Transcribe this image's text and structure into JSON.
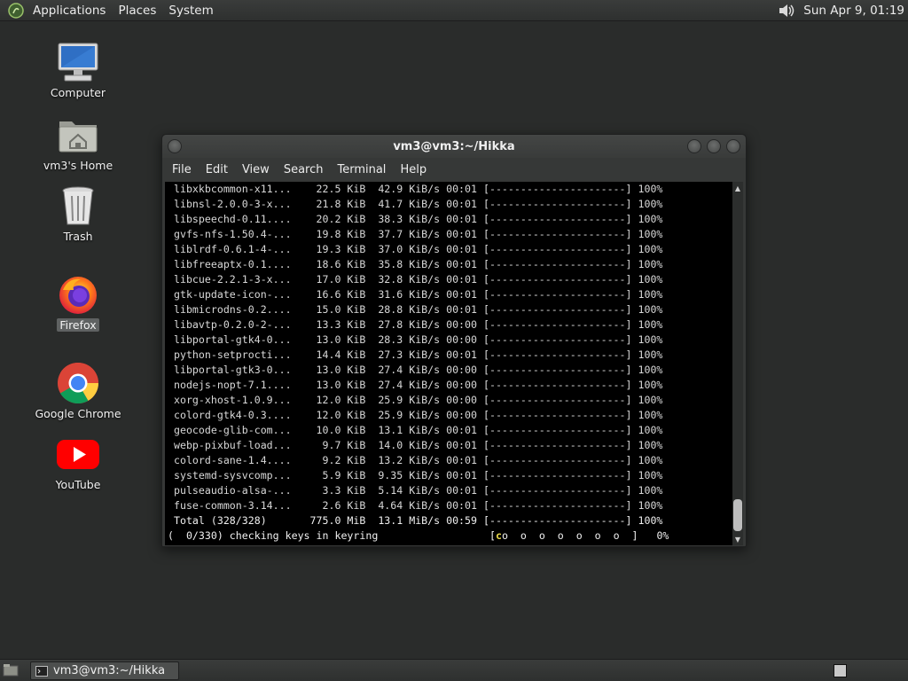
{
  "top_panel": {
    "menus": [
      "Applications",
      "Places",
      "System"
    ],
    "clock": "Sun Apr  9, 01:19"
  },
  "desktop_icons": [
    {
      "label": "Computer",
      "icon": "computer-icon"
    },
    {
      "label": "vm3's Home",
      "icon": "home-folder-icon"
    },
    {
      "label": "Trash",
      "icon": "trash-icon"
    },
    {
      "label": "Firefox",
      "icon": "firefox-icon"
    },
    {
      "label": "Google Chrome",
      "icon": "chrome-icon"
    },
    {
      "label": "YouTube",
      "icon": "youtube-icon"
    }
  ],
  "terminal": {
    "title": "vm3@vm3:~/Hikka",
    "menu": [
      "File",
      "Edit",
      "View",
      "Search",
      "Terminal",
      "Help"
    ],
    "lines": [
      " libxkbcommon-x11...    22.5 KiB  42.9 KiB/s 00:01 [----------------------] 100%",
      " libnsl-2.0.0-3-x...    21.8 KiB  41.7 KiB/s 00:01 [----------------------] 100%",
      " libspeechd-0.11....    20.2 KiB  38.3 KiB/s 00:01 [----------------------] 100%",
      " gvfs-nfs-1.50.4-...    19.8 KiB  37.7 KiB/s 00:01 [----------------------] 100%",
      " liblrdf-0.6.1-4-...    19.3 KiB  37.0 KiB/s 00:01 [----------------------] 100%",
      " libfreeaptx-0.1....    18.6 KiB  35.8 KiB/s 00:01 [----------------------] 100%",
      " libcue-2.2.1-3-x...    17.0 KiB  32.8 KiB/s 00:01 [----------------------] 100%",
      " gtk-update-icon-...    16.6 KiB  31.6 KiB/s 00:01 [----------------------] 100%",
      " libmicrodns-0.2....    15.0 KiB  28.8 KiB/s 00:01 [----------------------] 100%",
      " libavtp-0.2.0-2-...    13.3 KiB  27.8 KiB/s 00:00 [----------------------] 100%",
      " libportal-gtk4-0...    13.0 KiB  28.3 KiB/s 00:00 [----------------------] 100%",
      " python-setprocti...    14.4 KiB  27.3 KiB/s 00:01 [----------------------] 100%",
      " libportal-gtk3-0...    13.0 KiB  27.4 KiB/s 00:00 [----------------------] 100%",
      " nodejs-nopt-7.1....    13.0 KiB  27.4 KiB/s 00:00 [----------------------] 100%",
      " xorg-xhost-1.0.9...    12.0 KiB  25.9 KiB/s 00:00 [----------------------] 100%",
      " colord-gtk4-0.3....    12.0 KiB  25.9 KiB/s 00:00 [----------------------] 100%",
      " geocode-glib-com...    10.0 KiB  13.1 KiB/s 00:01 [----------------------] 100%",
      " webp-pixbuf-load...     9.7 KiB  14.0 KiB/s 00:01 [----------------------] 100%",
      " colord-sane-1.4....     9.2 KiB  13.2 KiB/s 00:01 [----------------------] 100%",
      " systemd-sysvcomp...     5.9 KiB  9.35 KiB/s 00:01 [----------------------] 100%",
      " pulseaudio-alsa-...     3.3 KiB  5.14 KiB/s 00:01 [----------------------] 100%",
      " fuse-common-3.14...     2.6 KiB  4.64 KiB/s 00:01 [----------------------] 100%",
      " Total (328/328)       775.0 MiB  13.1 MiB/s 00:59 [----------------------] 100%"
    ],
    "status_line": {
      "prefix": "(  0/330) checking keys in keyring                  [",
      "pac": "c",
      "dots": "o  o  o  o  o  o  o  ]   0%"
    }
  },
  "taskbar": {
    "task_label": "vm3@vm3:~/Hikka"
  }
}
